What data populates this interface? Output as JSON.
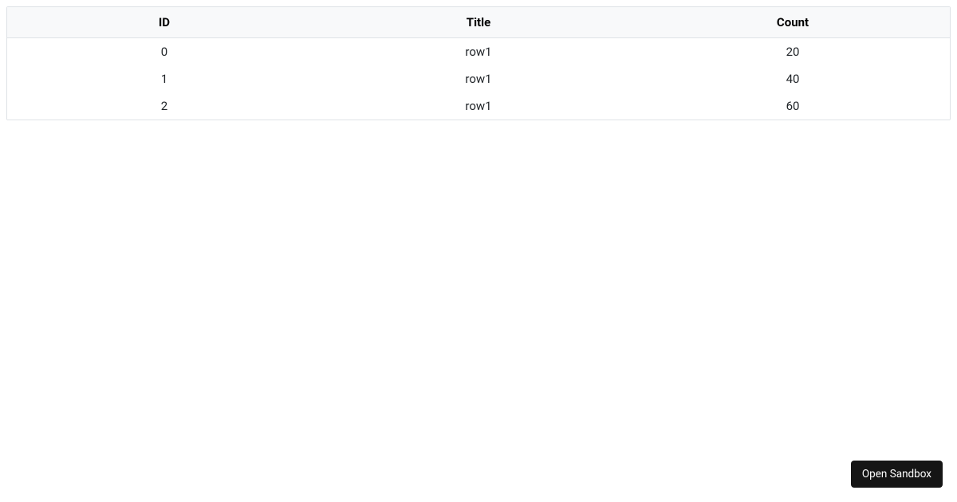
{
  "table": {
    "headers": [
      "ID",
      "Title",
      "Count"
    ],
    "rows": [
      {
        "id": "0",
        "title": "row1",
        "count": "20"
      },
      {
        "id": "1",
        "title": "row1",
        "count": "40"
      },
      {
        "id": "2",
        "title": "row1",
        "count": "60"
      }
    ]
  },
  "buttons": {
    "open_sandbox": "Open Sandbox"
  }
}
